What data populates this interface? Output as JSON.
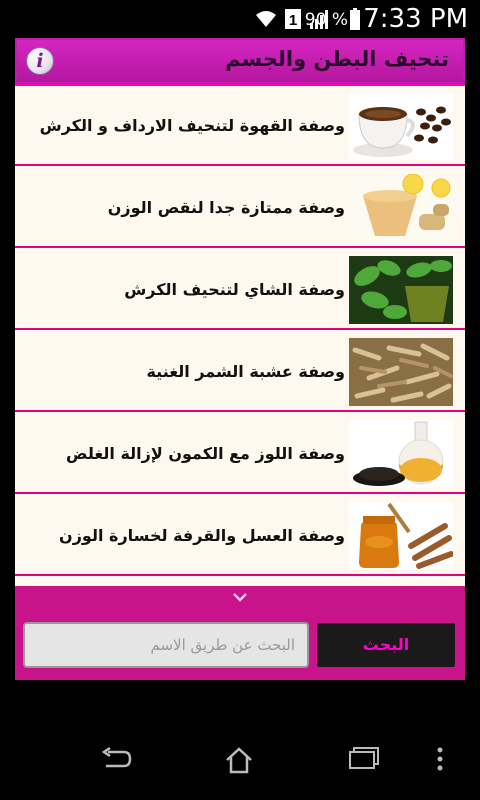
{
  "status_bar": {
    "battery_percent": "90 %",
    "time": "7:33 PM",
    "sim_badge": "1"
  },
  "header": {
    "title": "تنحيف البطن والجسم",
    "info_icon_glyph": "i"
  },
  "recipes": [
    {
      "label": "وصفة القهوة لتنحيف الارداف و الكرش",
      "thumb": "coffee-cup"
    },
    {
      "label": "وصفة ممتازة جدا لنقص الوزن",
      "thumb": "ginger-lemon-drink"
    },
    {
      "label": "وصفة الشاي لتنحيف الكرش",
      "thumb": "mint-tea"
    },
    {
      "label": "وصفة عشبة الشمر الغنية",
      "thumb": "fennel-herb"
    },
    {
      "label": "وصفة اللوز مع الكمون لإزالة الغلض",
      "thumb": "cumin-flask"
    },
    {
      "label": "وصفة العسل والقرفة لخسارة الوزن",
      "thumb": "honey-cinnamon"
    }
  ],
  "search": {
    "placeholder": "البحث عن طريق الاسم",
    "button_label": "البحث"
  },
  "colors": {
    "accent": "#ff00b4",
    "header": "#c11bb0",
    "row_divider": "#e6007e",
    "list_bg": "#fff8ee"
  }
}
